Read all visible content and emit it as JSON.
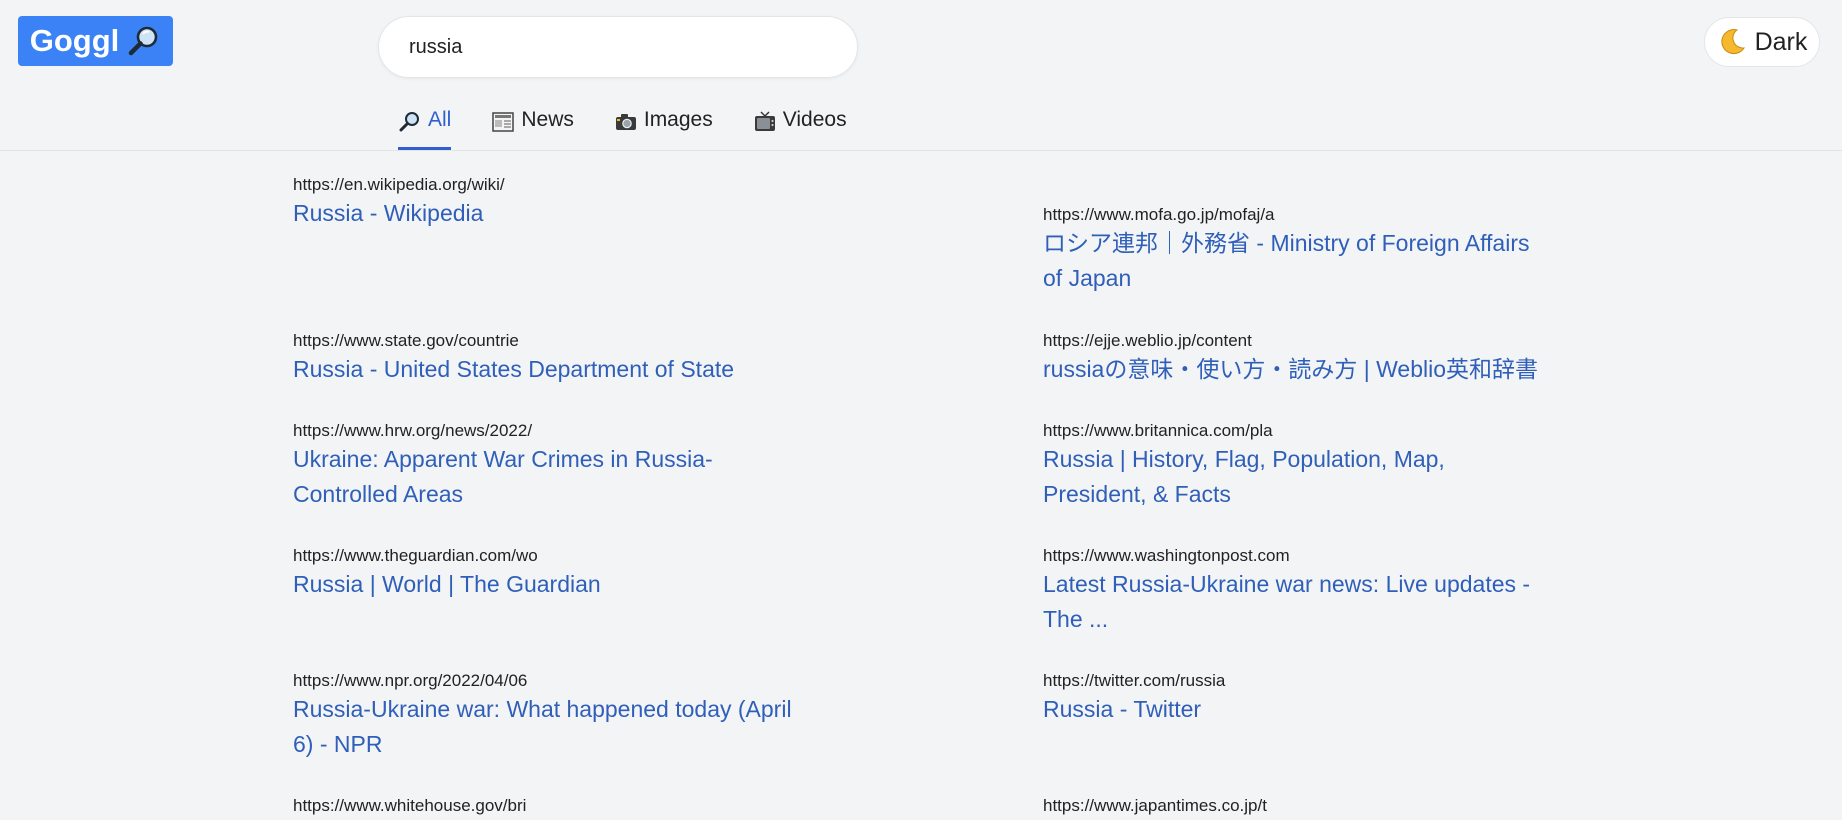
{
  "logo": {
    "text": "Goggl"
  },
  "search": {
    "value": "russia"
  },
  "theme_toggle": {
    "label": "Dark"
  },
  "tabs": [
    {
      "label": "All",
      "icon": "magnifier-icon",
      "active": true
    },
    {
      "label": "News",
      "icon": "newspaper-icon",
      "active": false
    },
    {
      "label": "Images",
      "icon": "camera-icon",
      "active": false
    },
    {
      "label": "Videos",
      "icon": "tv-icon",
      "active": false
    }
  ],
  "results": [
    {
      "url": "https://en.wikipedia.org/wiki/",
      "title": "Russia - Wikipedia"
    },
    {
      "url": "https://www.mofa.go.jp/mofaj/a",
      "title": "ロシア連邦｜外務省 - Ministry of Foreign Affairs of Japan"
    },
    {
      "url": "https://www.state.gov/countrie",
      "title": "Russia - United States Department of State"
    },
    {
      "url": "https://ejje.weblio.jp/content",
      "title": "russiaの意味・使い方・読み方 | Weblio英和辞書"
    },
    {
      "url": "https://www.hrw.org/news/2022/",
      "title": "Ukraine: Apparent War Crimes in Russia-Controlled Areas"
    },
    {
      "url": "https://www.britannica.com/pla",
      "title": "Russia | History, Flag, Population, Map, President, & Facts"
    },
    {
      "url": "https://www.theguardian.com/wo",
      "title": "Russia | World | The Guardian"
    },
    {
      "url": "https://www.washingtonpost.com",
      "title": "Latest Russia-Ukraine war news: Live updates - The ..."
    },
    {
      "url": "https://www.npr.org/2022/04/06",
      "title": "Russia-Ukraine war: What happened today (April 6) - NPR"
    },
    {
      "url": "https://twitter.com/russia",
      "title": "Russia - Twitter"
    },
    {
      "url": "https://www.whitehouse.gov/bri",
      "title": ""
    },
    {
      "url": "https://www.japantimes.co.jp/t",
      "title": ""
    }
  ],
  "colors": {
    "accent": "#3b82f6",
    "link": "#2f5fb8",
    "background": "#f3f4f6"
  }
}
